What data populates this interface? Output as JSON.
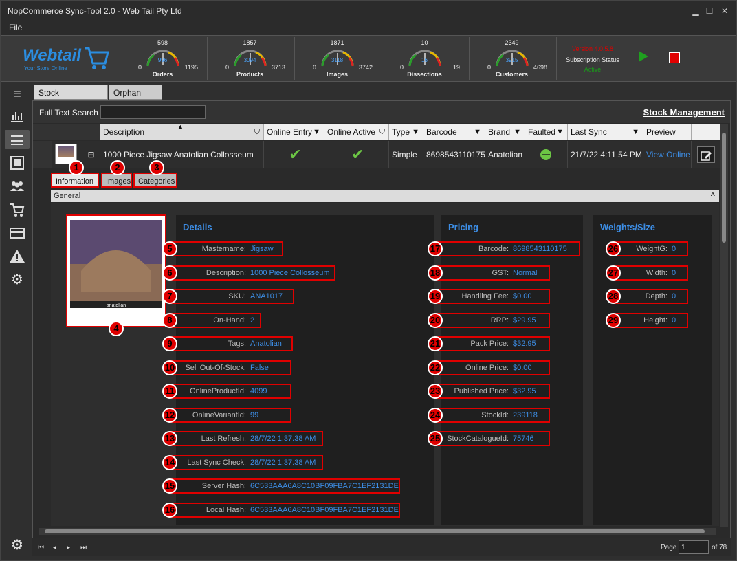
{
  "window": {
    "title": "NopCommerce Sync-Tool 2.0 - Web Tail Pty Ltd"
  },
  "menu": {
    "file": "File"
  },
  "logo": {
    "brand": "Webtail",
    "tagline": "Your Store Online"
  },
  "gauges": [
    {
      "top": "598",
      "min": "0",
      "max": "1195",
      "current": "996",
      "label": "Orders",
      "fraction": 0.5
    },
    {
      "top": "1857",
      "min": "0",
      "max": "3713",
      "current": "3094",
      "label": "Products",
      "fraction": 0.5
    },
    {
      "top": "1871",
      "min": "0",
      "max": "3742",
      "current": "3118",
      "label": "Images",
      "fraction": 0.5
    },
    {
      "top": "10",
      "min": "0",
      "max": "19",
      "current": "16",
      "label": "Dissections",
      "fraction": 0.5
    },
    {
      "top": "2349",
      "min": "0",
      "max": "4698",
      "current": "3915",
      "label": "Customers",
      "fraction": 0.5
    }
  ],
  "subscription": {
    "version": "Version 4.0.5.8",
    "label": "Subscription Status",
    "status": "Active"
  },
  "tabs": {
    "stock": "Stock Management",
    "orphan": "Orphan Stock"
  },
  "search": {
    "label": "Full Text Search",
    "value": "",
    "title": "Stock Management"
  },
  "grid": {
    "headers": {
      "description": "Description",
      "online_entry": "Online Entry",
      "online_active": "Online Active",
      "type": "Type",
      "barcode": "Barcode",
      "brand": "Brand",
      "faulted": "Faulted",
      "last_sync": "Last Sync",
      "preview": "Preview"
    },
    "row": {
      "expander": "⊟",
      "description": "1000 Piece Jigsaw  Anatolian Collosseum",
      "online_entry": "✔",
      "online_active": "✔",
      "type": "Simple",
      "barcode": "8698543110175",
      "brand": "Anatolian",
      "faulted": "—",
      "last_sync": "21/7/22 4:11.54 PM",
      "preview": "View Online"
    }
  },
  "detail_tabs": {
    "information": "Information",
    "images": "Images",
    "categories": "Categories"
  },
  "general": {
    "label": "General",
    "collapse": "^"
  },
  "image": {
    "brand_text": "anatolian"
  },
  "details": {
    "title": "Details",
    "fields": [
      {
        "n": "5",
        "label": "Mastername:",
        "value": "Jigsaw"
      },
      {
        "n": "6",
        "label": "Description:",
        "value": "1000 Piece Collosseum"
      },
      {
        "n": "7",
        "label": "SKU:",
        "value": "ANA1017"
      },
      {
        "n": "8",
        "label": "On-Hand:",
        "value": "2"
      },
      {
        "n": "9",
        "label": "Tags:",
        "value": "Anatolian"
      },
      {
        "n": "10",
        "label": "Sell Out-Of-Stock:",
        "value": "False"
      },
      {
        "n": "11",
        "label": "OnlineProductId:",
        "value": "4099"
      },
      {
        "n": "12",
        "label": "OnlineVariantId:",
        "value": "99"
      },
      {
        "n": "13",
        "label": "Last Refresh:",
        "value": "28/7/22 1:37.38 AM"
      },
      {
        "n": "14",
        "label": "Last Sync Check:",
        "value": "28/7/22 1:37.38 AM"
      },
      {
        "n": "15",
        "label": "Server Hash:",
        "value": "6C533AAA6A8C10BF09FBA7C1EF2131DE"
      },
      {
        "n": "16",
        "label": "Local Hash:",
        "value": "6C533AAA6A8C10BF09FBA7C1EF2131DE"
      }
    ]
  },
  "pricing": {
    "title": "Pricing",
    "fields": [
      {
        "n": "17",
        "label": "Barcode:",
        "value": "8698543110175"
      },
      {
        "n": "18",
        "label": "GST:",
        "value": "Normal"
      },
      {
        "n": "19",
        "label": "Handling Fee:",
        "value": "$0.00"
      },
      {
        "n": "20",
        "label": "RRP:",
        "value": "$29.95"
      },
      {
        "n": "21",
        "label": "Pack Price:",
        "value": "$32.95"
      },
      {
        "n": "22",
        "label": "Online Price:",
        "value": "$0.00"
      },
      {
        "n": "23",
        "label": "Published Price:",
        "value": "$32.95"
      },
      {
        "n": "24",
        "label": "StockId:",
        "value": "239118"
      },
      {
        "n": "25",
        "label": "StockCatalogueId:",
        "value": "75746"
      }
    ]
  },
  "weights": {
    "title": "Weights/Size",
    "fields": [
      {
        "n": "26",
        "label": "WeightG:",
        "value": "0"
      },
      {
        "n": "27",
        "label": "Width:",
        "value": "0"
      },
      {
        "n": "28",
        "label": "Depth:",
        "value": "0"
      },
      {
        "n": "29",
        "label": "Height:",
        "value": "0"
      }
    ]
  },
  "badges": {
    "b1": "1",
    "b2": "2",
    "b3": "3",
    "b4": "4"
  },
  "footer": {
    "page_label": "Page",
    "page_value": "1",
    "of_label": "of 78"
  }
}
